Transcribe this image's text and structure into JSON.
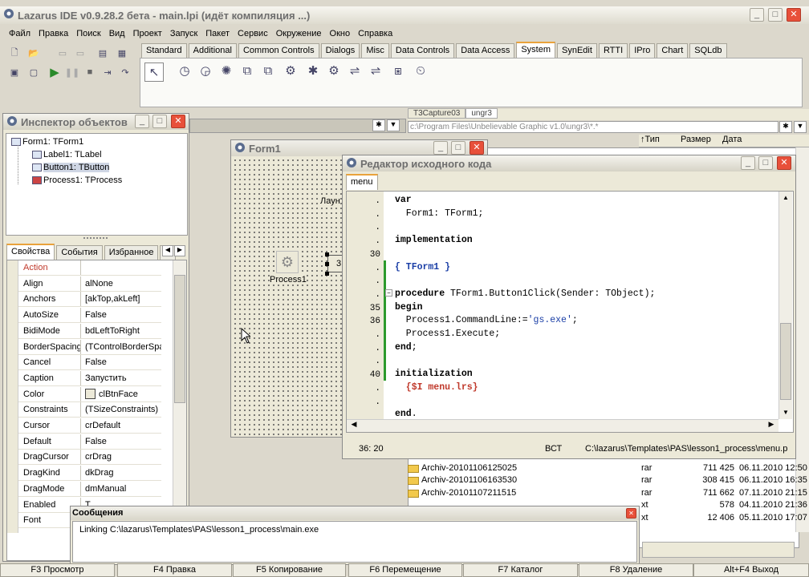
{
  "main": {
    "title": "Lazarus IDE v0.9.28.2 бета - main.lpi (идёт компиляция ...)",
    "menu": [
      "Файл",
      "Правка",
      "Поиск",
      "Вид",
      "Проект",
      "Запуск",
      "Пакет",
      "Сервис",
      "Окружение",
      "Окно",
      "Справка"
    ],
    "palette_tabs": [
      "Standard",
      "Additional",
      "Common Controls",
      "Dialogs",
      "Misc",
      "Data Controls",
      "Data Access",
      "System",
      "SynEdit",
      "RTTI",
      "IPro",
      "Chart",
      "SQLdb"
    ],
    "active_tab": "System",
    "palette_icons": [
      "pointer-icon",
      "timer-icon",
      "idle-timer-icon",
      "lazarus-icon",
      "html-icon",
      "html-icon",
      "process-icon",
      "utf8-icon",
      "gear-icon",
      "ipc-icon",
      "ipc-icon",
      "xml-icon",
      "clock-icon"
    ]
  },
  "inspector": {
    "title": "Инспектор объектов",
    "tree": [
      "Form1: TForm1",
      "Label1: TLabel",
      "Button1: TButton",
      "Process1: TProcess"
    ],
    "tabs": [
      "Свойства",
      "События",
      "Избранное",
      "С"
    ],
    "props": [
      {
        "n": "Action",
        "v": "",
        "exp": false
      },
      {
        "n": "Align",
        "v": "alNone",
        "exp": false
      },
      {
        "n": "Anchors",
        "v": "[akTop,akLeft]",
        "exp": true
      },
      {
        "n": "AutoSize",
        "v": "False",
        "exp": false
      },
      {
        "n": "BidiMode",
        "v": "bdLeftToRight",
        "exp": false
      },
      {
        "n": "BorderSpacing",
        "v": "(TControlBorderSpa",
        "exp": true
      },
      {
        "n": "Cancel",
        "v": "False",
        "exp": false
      },
      {
        "n": "Caption",
        "v": "Запустить",
        "exp": false
      },
      {
        "n": "Color",
        "v": "clBtnFace",
        "exp": false
      },
      {
        "n": "Constraints",
        "v": "(TSizeConstraints)",
        "exp": true
      },
      {
        "n": "Cursor",
        "v": "crDefault",
        "exp": false
      },
      {
        "n": "Default",
        "v": "False",
        "exp": false
      },
      {
        "n": "DragCursor",
        "v": "crDrag",
        "exp": false
      },
      {
        "n": "DragKind",
        "v": "dkDrag",
        "exp": false
      },
      {
        "n": "DragMode",
        "v": "dmManual",
        "exp": false
      },
      {
        "n": "Enabled",
        "v": "T",
        "exp": false
      },
      {
        "n": "Font",
        "v": "",
        "exp": true
      }
    ]
  },
  "form1": {
    "title": "Form1",
    "process_caption": "Process1",
    "label_text": "Лаун",
    "button_text": "3"
  },
  "editor": {
    "title": "Редактор исходного кода",
    "tab": "menu",
    "gutter": [
      ".",
      ".",
      ".",
      ".",
      "30",
      ".",
      ".",
      ".",
      "35",
      "36",
      ".",
      ".",
      ".",
      "40",
      ".",
      "."
    ],
    "lines": [
      [
        [
          "kw",
          "var"
        ]
      ],
      [
        [
          "n",
          "  Form1: TForm1;"
        ]
      ],
      [
        [
          "n",
          ""
        ]
      ],
      [
        [
          "kw",
          "implementation"
        ]
      ],
      [
        [
          "n",
          ""
        ]
      ],
      [
        [
          "c",
          "{ TForm1 }"
        ]
      ],
      [
        [
          "n",
          ""
        ]
      ],
      [
        [
          "kw",
          "procedure"
        ],
        [
          "n",
          " TForm1.Button1Click(Sender: TObject);"
        ]
      ],
      [
        [
          "kw",
          "begin"
        ]
      ],
      [
        [
          "n",
          "  Process1.CommandLine:="
        ],
        [
          "s",
          "'gs.exe'"
        ],
        [
          "n",
          ";"
        ]
      ],
      [
        [
          "n",
          "  Process1.Execute;"
        ]
      ],
      [
        [
          "kw",
          "end"
        ],
        [
          "n",
          ";"
        ]
      ],
      [
        [
          "n",
          ""
        ]
      ],
      [
        [
          "kw",
          "initialization"
        ]
      ],
      [
        [
          "d",
          "  {$I menu.lrs}"
        ]
      ],
      [
        [
          "n",
          ""
        ]
      ],
      [
        [
          "kw",
          "end"
        ],
        [
          "n",
          "."
        ]
      ]
    ],
    "status": {
      "pos": "36: 20",
      "mode": "ВСТ",
      "file": "C:\\lazarus\\Templates\\PAS\\lesson1_process\\menu.p"
    }
  },
  "filemgr": {
    "tabs": [
      "T3Capture03",
      "ungr3"
    ],
    "path": "c:\\Program Files\\Unbelievable Graphic v1.0\\ungr3\\*.*",
    "cols": [
      "↑Тип",
      "Размер",
      "Дата"
    ],
    "files": [
      {
        "name": "Archiv-20101106125025",
        "type": "rar",
        "size": "711 425",
        "date": "06.11.2010 12:50"
      },
      {
        "name": "Archiv-20101106163530",
        "type": "rar",
        "size": "308 415",
        "date": "06.11.2010 16:35"
      },
      {
        "name": "Archiv-20101107211515",
        "type": "rar",
        "size": "711 662",
        "date": "07.11.2010 21:15"
      },
      {
        "name": "",
        "type": "xt",
        "size": "578",
        "date": "04.11.2010 21:36"
      },
      {
        "name": "",
        "type": "xt",
        "size": "12 406",
        "date": "05.11.2010 17:07"
      }
    ]
  },
  "messages": {
    "title": "Сообщения",
    "text": "Linking C:\\lazarus\\Templates\\PAS\\lesson1_process\\main.exe"
  },
  "fkeys": [
    "F3 Просмотр",
    "F4 Правка",
    "F5 Копирование",
    "F6 Перемещение",
    "F7 Каталог",
    "F8 Удаление",
    "Alt+F4 Выход"
  ]
}
